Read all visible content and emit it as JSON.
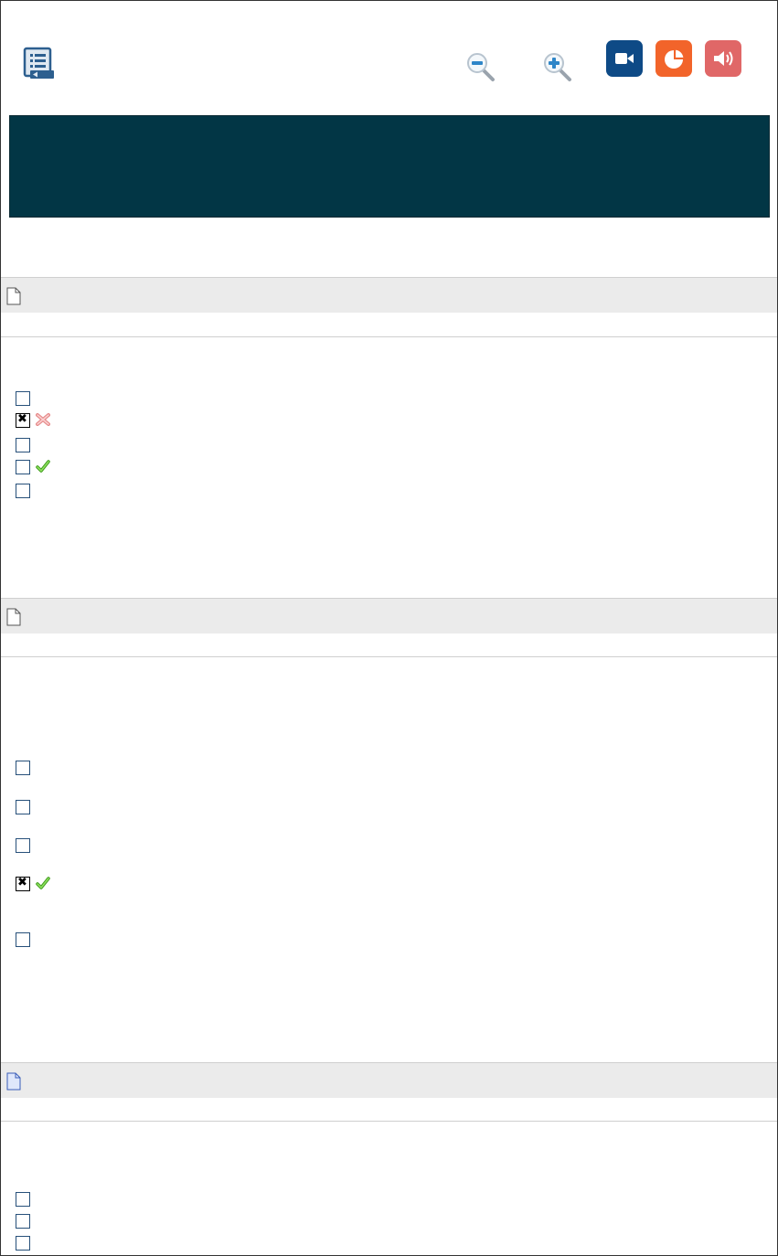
{
  "toolbar": {
    "toc_icon": "table-of-contents-icon",
    "zoom_out_icon": "zoom-out-icon",
    "zoom_in_icon": "zoom-in-icon",
    "video_icon": "video-camera-icon",
    "chart_icon": "pie-chart-icon",
    "audio_icon": "speaker-icon",
    "colors": {
      "video": "#0e4a86",
      "chart": "#f2642a",
      "audio": "#e06767",
      "zoom": "#3aa0d8"
    }
  },
  "banner": {
    "text": "",
    "color": "#023645"
  },
  "questions": [
    {
      "doc_icon": "page-icon",
      "title": "",
      "options": [
        {
          "checked": false,
          "mark": null,
          "text": ""
        },
        {
          "checked": true,
          "mark": "incorrect",
          "text": ""
        },
        {
          "checked": false,
          "mark": null,
          "text": ""
        },
        {
          "checked": false,
          "mark": "correct",
          "text": ""
        },
        {
          "checked": false,
          "mark": null,
          "text": ""
        }
      ]
    },
    {
      "doc_icon": "page-icon",
      "title": "",
      "options": [
        {
          "checked": false,
          "mark": null,
          "text": ""
        },
        {
          "checked": false,
          "mark": null,
          "text": ""
        },
        {
          "checked": false,
          "mark": null,
          "text": ""
        },
        {
          "checked": true,
          "mark": "correct",
          "text": ""
        },
        {
          "checked": false,
          "mark": null,
          "text": ""
        }
      ]
    },
    {
      "doc_icon": "page-blue-icon",
      "title": "",
      "options": [
        {
          "checked": false,
          "mark": null,
          "text": ""
        },
        {
          "checked": false,
          "mark": null,
          "text": ""
        },
        {
          "checked": false,
          "mark": null,
          "text": ""
        }
      ]
    }
  ]
}
